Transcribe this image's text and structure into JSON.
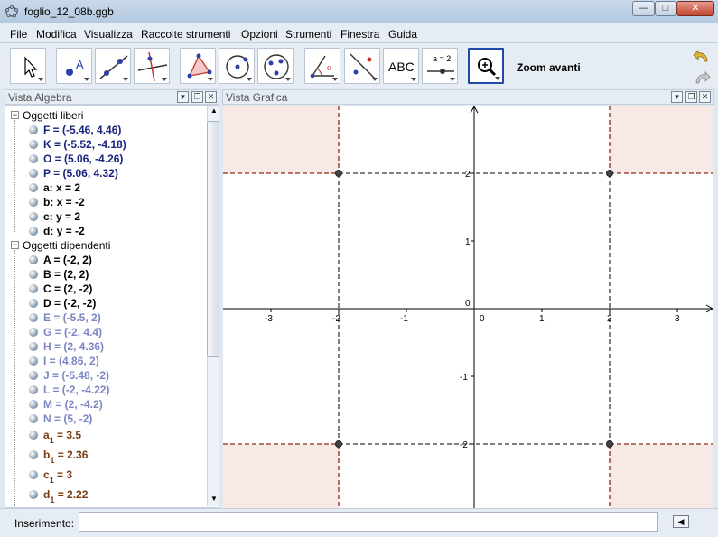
{
  "window": {
    "title": "foglio_12_08b.ggb",
    "controls": {
      "minimize": "—",
      "maximize": "□",
      "close": "✕"
    }
  },
  "menu": [
    "File",
    "Modifica",
    "Visualizza",
    "Raccolte strumenti",
    "Opzioni",
    "Strumenti",
    "Finestra",
    "Guida"
  ],
  "toolbar": {
    "tools": [
      "move-icon",
      "point-icon",
      "line-icon",
      "perpendicular-icon",
      "polygon-icon",
      "circle-icon",
      "conic-icon",
      "angle-icon",
      "reflect-icon",
      "text-icon",
      "slider-icon",
      "zoom-in-icon"
    ],
    "text_tool_label": "ABC",
    "slider_tool_label": "a = 2",
    "active_tool_label": "Zoom avanti"
  },
  "algebra": {
    "title": "Vista Algebra",
    "free_group": "Oggetti liberi",
    "free_items": [
      {
        "text": "F = (-5.46, 4.46)",
        "color": "#1a237e"
      },
      {
        "text": "K = (-5.52, -4.18)",
        "color": "#1a237e"
      },
      {
        "text": "O = (5.06, -4.26)",
        "color": "#1a237e"
      },
      {
        "text": "P = (5.06, 4.32)",
        "color": "#1a237e"
      },
      {
        "text": "a: x = 2",
        "color": "#000000"
      },
      {
        "text": "b: x = -2",
        "color": "#000000"
      },
      {
        "text": "c: y = 2",
        "color": "#000000"
      },
      {
        "text": "d: y = -2",
        "color": "#000000"
      }
    ],
    "dependent_group": "Oggetti dipendenti",
    "dependent_items": [
      {
        "text": "A = (-2, 2)",
        "color": "#000000"
      },
      {
        "text": "B = (2, 2)",
        "color": "#000000"
      },
      {
        "text": "C = (2, -2)",
        "color": "#000000"
      },
      {
        "text": "D = (-2, -2)",
        "color": "#000000"
      },
      {
        "text": "E = (-5.5, 2)",
        "color": "#7c86c4"
      },
      {
        "text": "G = (-2, 4.4)",
        "color": "#7c86c4"
      },
      {
        "text": "H = (2, 4.36)",
        "color": "#7c86c4"
      },
      {
        "text": "I = (4.86, 2)",
        "color": "#7c86c4"
      },
      {
        "text": "J = (-5.48, -2)",
        "color": "#7c86c4"
      },
      {
        "text": "L = (-2, -4.22)",
        "color": "#7c86c4"
      },
      {
        "text": "M = (2, -4.2)",
        "color": "#7c86c4"
      },
      {
        "text": "N = (5, -2)",
        "color": "#7c86c4"
      }
    ],
    "numeric_items": [
      {
        "name": "a",
        "sub": "1",
        "value": "= 3.5"
      },
      {
        "name": "b",
        "sub": "1",
        "value": "= 2.36"
      },
      {
        "name": "c",
        "sub": "1",
        "value": "= 3"
      },
      {
        "name": "d",
        "sub": "1",
        "value": "= 2.22"
      }
    ]
  },
  "graphics": {
    "title": "Vista Grafica",
    "x_ticks": [
      "-3",
      "-2",
      "-1",
      "0",
      "1",
      "2",
      "3"
    ],
    "y_ticks": [
      "2",
      "1",
      "0",
      "-1",
      "-2"
    ],
    "region_color": "#f6e9e6",
    "line_color": "#8b2a10"
  },
  "input": {
    "label": "Inserimento:",
    "value": "",
    "placeholder": ""
  }
}
